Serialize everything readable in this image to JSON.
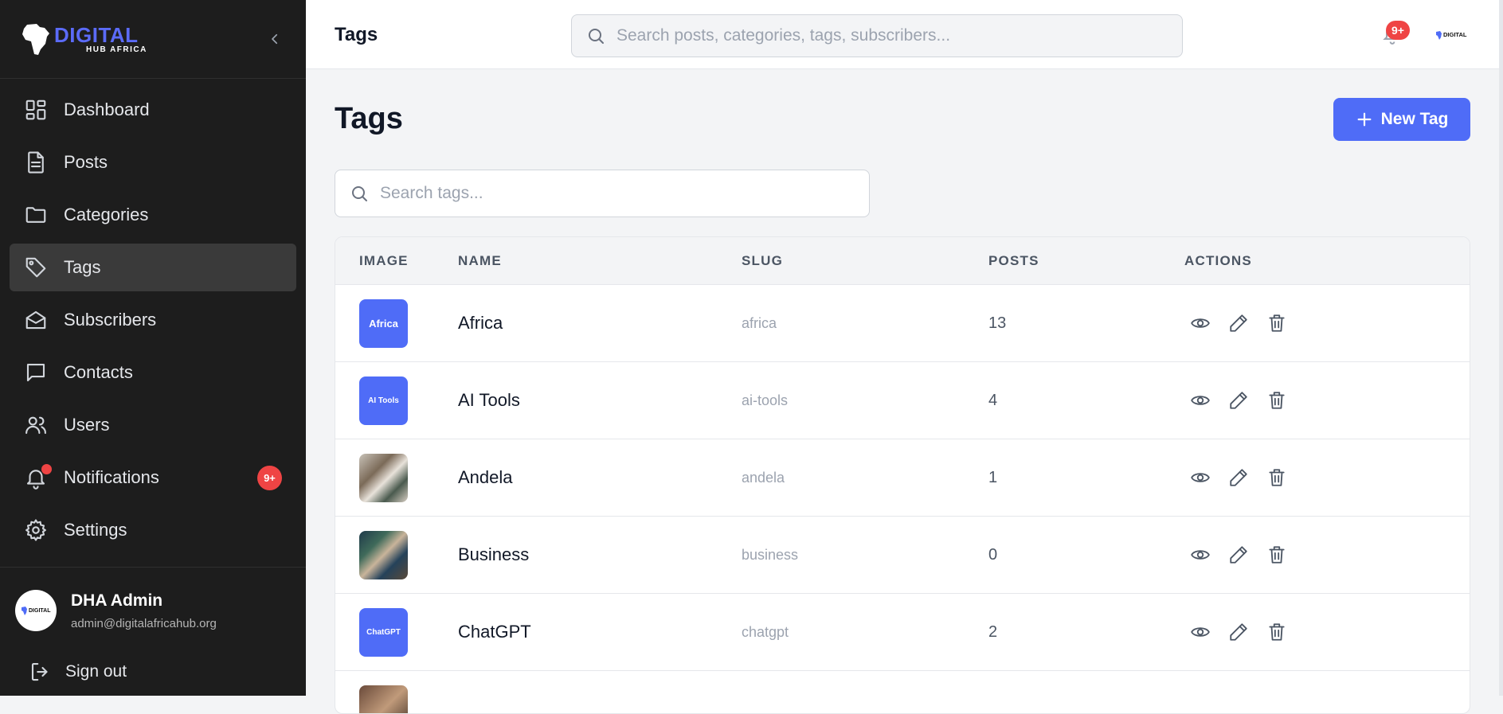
{
  "app": {
    "logo_main": "DIGITAL",
    "logo_sub": "HUB AFRICA",
    "avatar_logo_text": "DIGITAL"
  },
  "sidebar": {
    "items": [
      {
        "label": "Dashboard",
        "icon": "dashboard-icon"
      },
      {
        "label": "Posts",
        "icon": "document-icon"
      },
      {
        "label": "Categories",
        "icon": "folder-icon"
      },
      {
        "label": "Tags",
        "icon": "tag-icon",
        "active": true
      },
      {
        "label": "Subscribers",
        "icon": "envelope-open-icon"
      },
      {
        "label": "Contacts",
        "icon": "chat-icon"
      },
      {
        "label": "Users",
        "icon": "users-icon"
      },
      {
        "label": "Notifications",
        "icon": "bell-icon",
        "badge": "9+"
      },
      {
        "label": "Settings",
        "icon": "gear-icon"
      }
    ],
    "profile": {
      "name": "DHA Admin",
      "email": "admin@digitalafricahub.org"
    },
    "signout_label": "Sign out"
  },
  "topbar": {
    "title": "Tags",
    "search_placeholder": "Search posts, categories, tags, subscribers...",
    "notification_badge": "9+"
  },
  "main": {
    "title": "Tags",
    "new_button_label": "New Tag",
    "search_placeholder": "Search tags...",
    "table": {
      "columns": [
        "IMAGE",
        "NAME",
        "SLUG",
        "POSTS",
        "ACTIONS"
      ],
      "rows": [
        {
          "image_text": "Africa",
          "image_kind": "label",
          "name": "Africa",
          "slug": "africa",
          "posts": "13"
        },
        {
          "image_text": "AI Tools",
          "image_kind": "label",
          "name": "AI Tools",
          "slug": "ai-tools",
          "posts": "4"
        },
        {
          "image_text": "",
          "image_kind": "photo",
          "name": "Andela",
          "slug": "andela",
          "posts": "1"
        },
        {
          "image_text": "",
          "image_kind": "photo",
          "name": "Business",
          "slug": "business",
          "posts": "0"
        },
        {
          "image_text": "ChatGPT",
          "image_kind": "label",
          "name": "ChatGPT",
          "slug": "chatgpt",
          "posts": "2"
        }
      ]
    }
  },
  "colors": {
    "accent": "#4f6cf7",
    "sidebar_bg": "#1d1d1d",
    "badge": "#ef4444"
  }
}
